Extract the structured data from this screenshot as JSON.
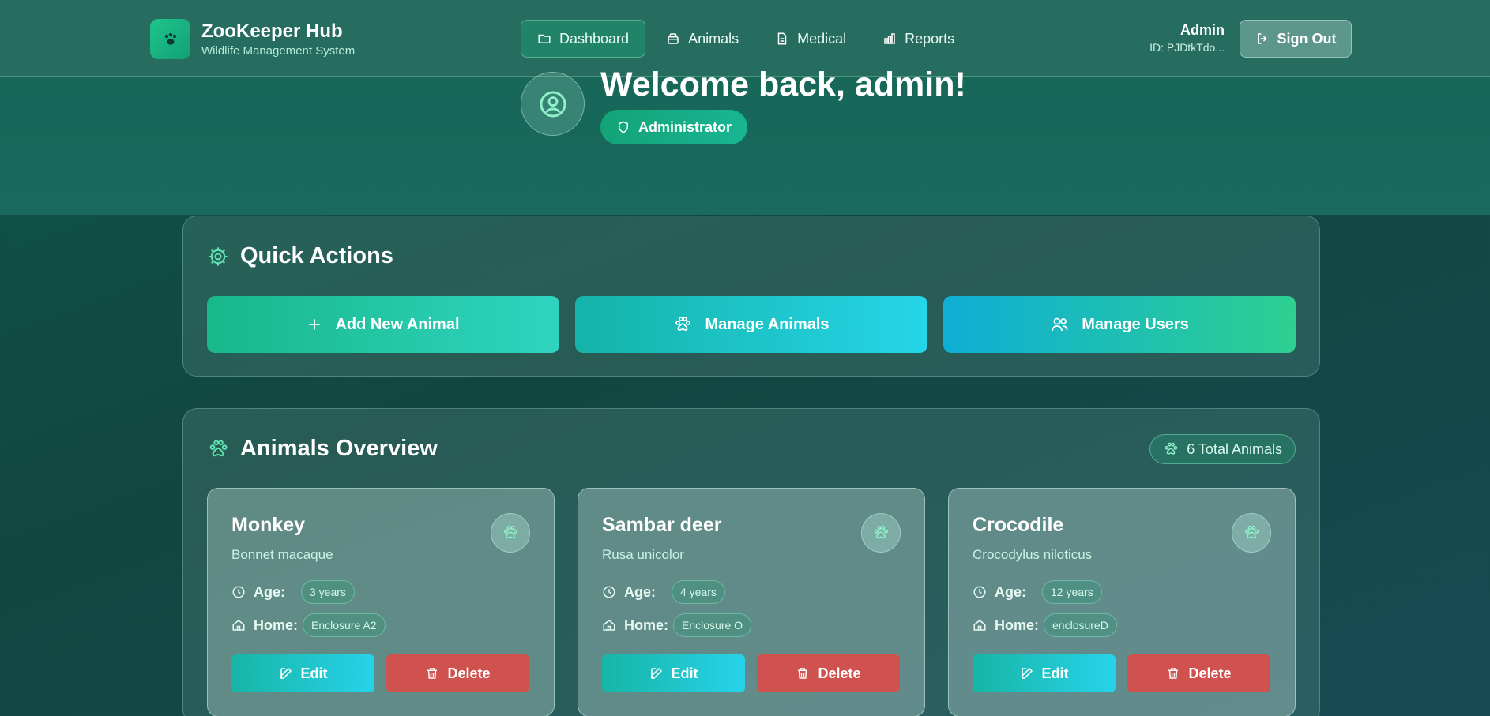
{
  "app": {
    "title": "ZooKeeper Hub",
    "subtitle": "Wildlife Management System",
    "logo_icon": "paw-icon"
  },
  "nav": {
    "items": [
      {
        "label": "Dashboard",
        "icon": "folder-icon",
        "active": true
      },
      {
        "label": "Animals",
        "icon": "archive-icon",
        "active": false
      },
      {
        "label": "Medical",
        "icon": "document-icon",
        "active": false
      },
      {
        "label": "Reports",
        "icon": "bar-chart-icon",
        "active": false
      }
    ]
  },
  "user": {
    "name": "Admin",
    "id": "ID: PJDtkTdo...",
    "signout_label": "Sign Out"
  },
  "welcome": {
    "title": "Welcome back, admin!",
    "role": "Administrator"
  },
  "quick_actions": {
    "title": "Quick Actions",
    "buttons": [
      {
        "label": "Add New Animal",
        "icon": "plus-icon"
      },
      {
        "label": "Manage Animals",
        "icon": "paw-icon"
      },
      {
        "label": "Manage Users",
        "icon": "users-icon"
      }
    ]
  },
  "animals_overview": {
    "title": "Animals Overview",
    "total_label": "6 Total Animals",
    "age_label": "Age:",
    "home_label": "Home:",
    "edit_label": "Edit",
    "delete_label": "Delete",
    "animals": [
      {
        "name": "Monkey",
        "scientific": "Bonnet macaque",
        "age": "3 years",
        "home": "Enclosure A2"
      },
      {
        "name": "Sambar deer",
        "scientific": "Rusa unicolor",
        "age": "4 years",
        "home": "Enclosure O"
      },
      {
        "name": "Crocodile",
        "scientific": "Crocodylus niloticus",
        "age": "12 years",
        "home": "enclosureD"
      }
    ]
  },
  "colors": {
    "accent": "#18b88a",
    "delete": "#d0524f",
    "edit": "#25d5e8"
  }
}
